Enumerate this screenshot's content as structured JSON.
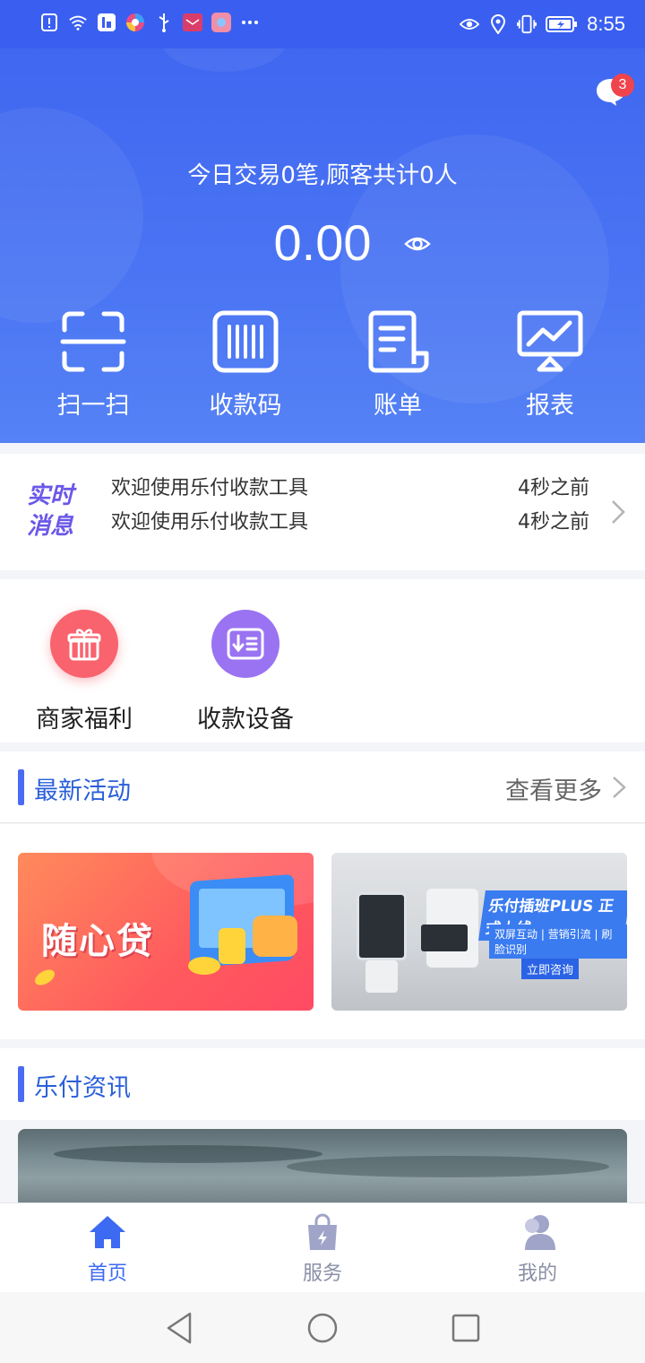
{
  "status_bar": {
    "time": "8:55",
    "left_icons": [
      "alert-icon",
      "wifi-icon",
      "app-icon",
      "browser-icon",
      "usb-icon",
      "huawei-icon",
      "gallery-icon",
      "more-icon"
    ],
    "right_icons": [
      "eye-care-icon",
      "location-icon",
      "vibrate-icon",
      "battery-icon"
    ]
  },
  "header": {
    "messages_badge": "3",
    "summary": "今日交易0笔,顾客共计0人",
    "amount": "0.00",
    "quick_actions": [
      {
        "label": "扫一扫",
        "icon": "scan-icon"
      },
      {
        "label": "收款码",
        "icon": "barcode-icon"
      },
      {
        "label": "账单",
        "icon": "bill-icon"
      },
      {
        "label": "报表",
        "icon": "report-icon"
      }
    ]
  },
  "realtime": {
    "logo_line1": "实时",
    "logo_line2": "消息",
    "items": [
      {
        "text": "欢迎使用乐付收款工具",
        "time": "4秒之前"
      },
      {
        "text": "欢迎使用乐付收款工具",
        "time": "4秒之前"
      }
    ]
  },
  "tools": [
    {
      "label": "商家福利",
      "icon": "gift-icon",
      "color": "#f8636e"
    },
    {
      "label": "收款设备",
      "icon": "device-icon",
      "color": "#9a73f2"
    }
  ],
  "activities": {
    "title": "最新活动",
    "more": "查看更多",
    "banners": [
      {
        "text": "随心贷"
      },
      {
        "title": "乐付插班PLUS 正式上线",
        "sub": "双屏互动 | 营销引流 | 刷脸识别",
        "button": "立即咨询"
      }
    ]
  },
  "news": {
    "title": "乐付资讯"
  },
  "bottom_nav": [
    {
      "label": "首页",
      "icon": "home-icon",
      "active": true
    },
    {
      "label": "服务",
      "icon": "service-bag-icon",
      "active": false
    },
    {
      "label": "我的",
      "icon": "profile-icon",
      "active": false
    }
  ],
  "colors": {
    "brand_blue": "#3d64f0",
    "accent_text": "#2a5fd8",
    "badge_red": "#f0444d"
  }
}
